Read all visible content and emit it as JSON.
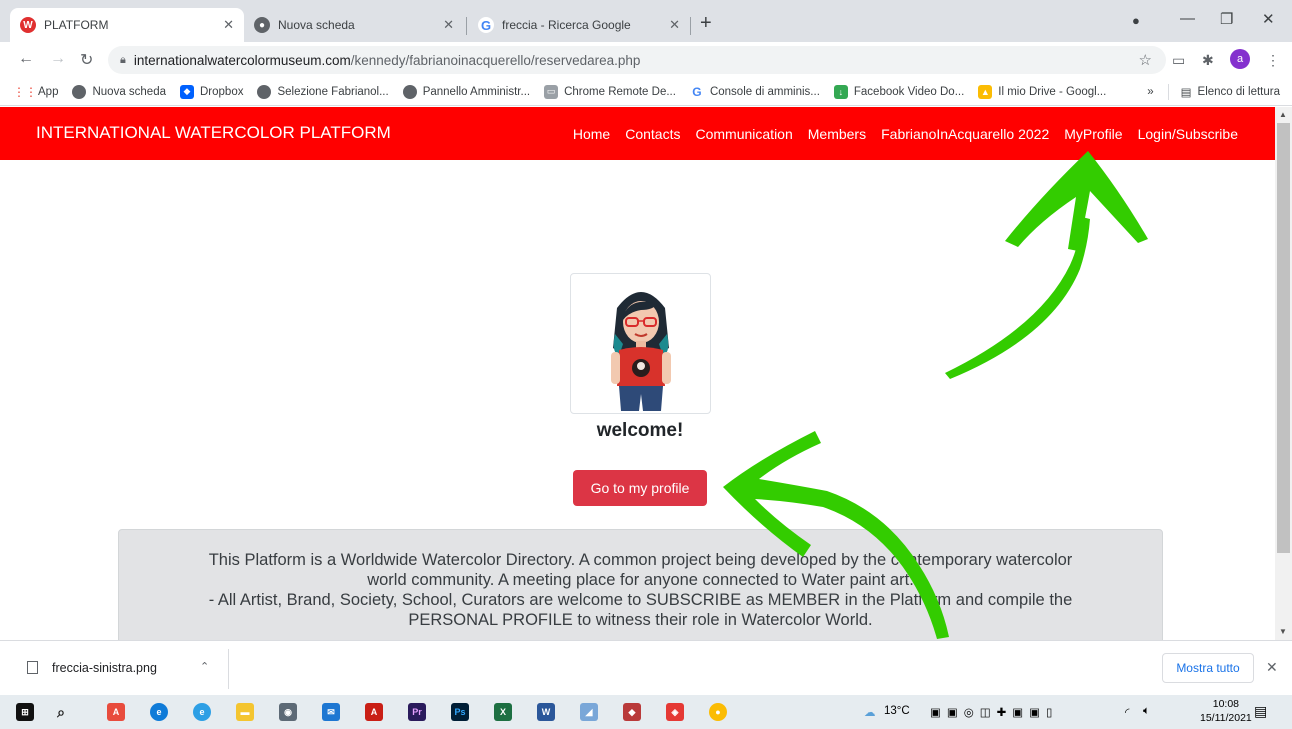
{
  "browser": {
    "tabs": [
      {
        "title": "PLATFORM",
        "favicon": "W",
        "favicon_color": "#e03030"
      },
      {
        "title": "Nuova scheda",
        "favicon": "chrome-icon",
        "favicon_color": "#5f6368"
      },
      {
        "title": "freccia - Ricerca Google",
        "favicon": "G",
        "favicon_color": "#4285f4"
      }
    ],
    "new_tab": "+",
    "url_host": "internationalwatercolormuseum.com",
    "url_path": "/kennedy/fabrianoinacquerello/reservedarea.php",
    "profile_initial": "a",
    "bookmarks": [
      {
        "label": "App",
        "icon": "apps-grid-icon",
        "color": "#4285f4"
      },
      {
        "label": "Nuova scheda",
        "icon": "globe-icon",
        "color": "#5f6368"
      },
      {
        "label": "Dropbox",
        "icon": "dropbox-icon",
        "color": "#0061fe"
      },
      {
        "label": "Selezione Fabrianol...",
        "icon": "globe-icon",
        "color": "#5f6368"
      },
      {
        "label": "Pannello Amministr...",
        "icon": "globe-icon",
        "color": "#5f6368"
      },
      {
        "label": "Chrome Remote De...",
        "icon": "remote-desktop-icon",
        "color": "#5f6368"
      },
      {
        "label": "Console di amminis...",
        "icon": "google-icon",
        "color": "#4285f4"
      },
      {
        "label": "Facebook Video Do...",
        "icon": "download-icon",
        "color": "#34a853"
      },
      {
        "label": "Il mio Drive - Googl...",
        "icon": "drive-icon",
        "color": "#fbbc04"
      }
    ],
    "bookmarks_more": "»",
    "reading_list": "Elenco di lettura"
  },
  "site": {
    "brand": "INTERNATIONAL WATERCOLOR PLATFORM",
    "nav": [
      "Home",
      "Contacts",
      "Communication",
      "Members",
      "FabrianoInAcquarello 2022",
      "MyProfile",
      "Login/Subscribe"
    ],
    "nav_color": "#ff0000",
    "welcome": "welcome!",
    "profile_button": "Go to my profile",
    "button_color": "#dc3545",
    "info_lines": [
      "This Platform is a Worldwide Watercolor Directory. A common project being developed by the contemporary watercolor",
      "world community. A meeting place for anyone connected to Water paint art.",
      "- All Artist, Brand, Society, School, Curators are welcome to SUBSCRIBE as MEMBER in the Platform and compile the",
      "PERSONAL PROFILE to witness their role in Watercolor World."
    ],
    "arrow_color": "#33cc00"
  },
  "downloads": {
    "file": "freccia-sinistra.png",
    "show_all": "Mostra tutto"
  },
  "taskbar": {
    "temperature": "13°C",
    "time": "10:08",
    "date": "15/11/2021"
  }
}
